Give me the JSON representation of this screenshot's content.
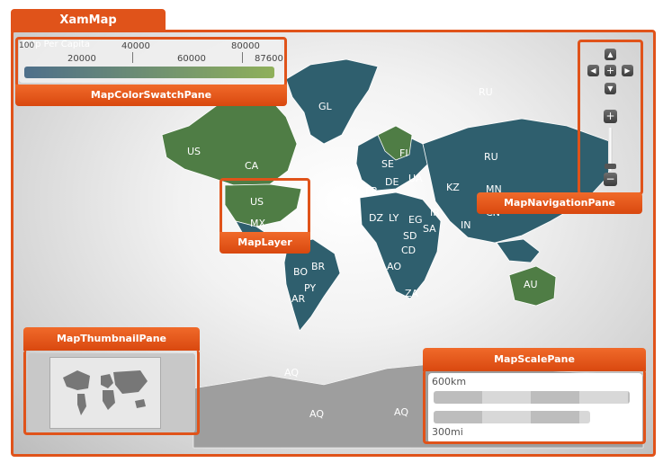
{
  "title": "XamMap",
  "color_swatch": {
    "caption": "Gdp Per Capita",
    "min_label": "100",
    "ticks_top": [
      "40000",
      "80000"
    ],
    "ticks_bottom": [
      "20000",
      "60000",
      "87600"
    ],
    "gradient_start": "#4e6f8a",
    "gradient_end": "#8fb05a"
  },
  "callouts": {
    "swatch": "MapColorSwatchPane",
    "navigation": "MapNavigationPane",
    "layer": "MapLayer",
    "thumbnail": "MapThumbnailPane",
    "scale": "MapScalePane"
  },
  "navigation": {
    "up": "▲",
    "down": "▼",
    "left": "◀",
    "right": "▶",
    "center": "+",
    "zoom_in": "+",
    "zoom_out": "−"
  },
  "scale": {
    "km_label": "600km",
    "mi_label": "300mi"
  },
  "map_labels": {
    "greenland": "GL",
    "russia": "RU",
    "russia_small": "RU",
    "us": "US",
    "us_alaska": "US",
    "canada": "CA",
    "mexico": "MX",
    "brazil": "BR",
    "australia": "AU",
    "antarctica_1": "AQ",
    "antarctica_2": "AQ",
    "antarctica_3": "AQ",
    "kazakhstan": "KZ",
    "mongolia": "MN",
    "india": "IN",
    "china": "CN",
    "europe_1": "SE",
    "europe_2": "FI",
    "europe_3": "DE",
    "europe_4": "FR",
    "europe_5": "UA",
    "africa_1": "DZ",
    "africa_2": "LY",
    "africa_3": "EG",
    "africa_4": "SD",
    "africa_5": "CD",
    "africa_6": "AO",
    "africa_7": "ZA",
    "sa_1": "BO",
    "sa_2": "AR",
    "sa_3": "PY",
    "me_1": "IR",
    "me_2": "SA"
  },
  "colors": {
    "accent": "#e0531a",
    "land_teal": "#2f5f6e",
    "land_green": "#4f7d45"
  }
}
